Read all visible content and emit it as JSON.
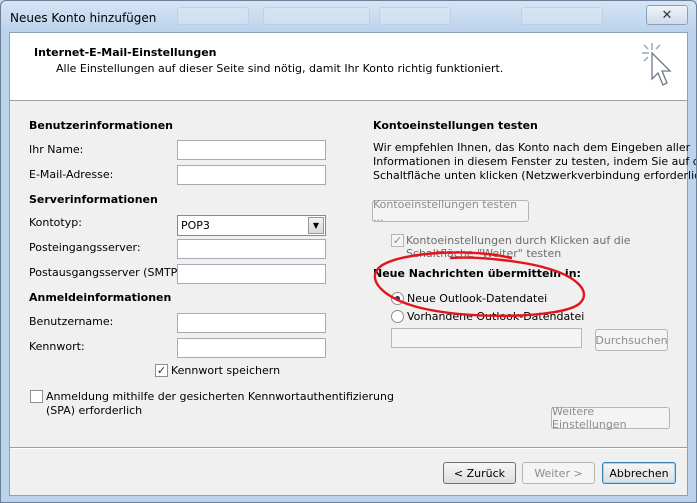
{
  "window": {
    "title": "Neues Konto hinzufügen",
    "close_label": "✕"
  },
  "header": {
    "title": "Internet-E-Mail-Einstellungen",
    "subtitle": "Alle Einstellungen auf dieser Seite sind nötig, damit Ihr Konto richtig funktioniert."
  },
  "user_info": {
    "heading": "Benutzerinformationen",
    "name_label": "Ihr Name:",
    "name_value": "",
    "email_label": "E-Mail-Adresse:",
    "email_value": ""
  },
  "server_info": {
    "heading": "Serverinformationen",
    "account_type_label": "Kontotyp:",
    "account_type_value": "POP3",
    "incoming_label": "Posteingangsserver:",
    "incoming_value": "",
    "outgoing_label": "Postausgangsserver (SMTP):",
    "outgoing_value": ""
  },
  "login_info": {
    "heading": "Anmeldeinformationen",
    "username_label": "Benutzername:",
    "username_value": "",
    "password_label": "Kennwort:",
    "password_value": "",
    "remember_password_label": "Kennwort speichern",
    "remember_password_checked": true,
    "spa_label_line1": "Anmeldung mithilfe der gesicherten Kennwortauthentifizierung",
    "spa_label_line2": "(SPA) erforderlich",
    "spa_checked": false
  },
  "test_settings": {
    "heading": "Kontoeinstellungen testen",
    "description_line1": "Wir empfehlen Ihnen, das Konto nach dem Eingeben aller",
    "description_line2": "Informationen in diesem Fenster zu testen, indem Sie auf die",
    "description_line3": "Schaltfläche unten klicken (Netzwerkverbindung erforderlich).",
    "test_button_label": "Kontoeinstellungen testen ...",
    "auto_test_line1": "Kontoeinstellungen durch Klicken auf die",
    "auto_test_line2": "Schaltfläche \"Weiter\" testen",
    "auto_test_checked": true
  },
  "deliver": {
    "heading": "Neue Nachrichten übermitteln in:",
    "option_new_label": "Neue Outlook-Datendatei",
    "option_existing_label": "Vorhandene Outlook-Datendatei",
    "selected": "new",
    "path_value": "",
    "browse_label": "Durchsuchen"
  },
  "more_settings_label": "Weitere Einstellungen",
  "footer": {
    "back_label": "< Zurück",
    "next_label": "Weiter >",
    "cancel_label": "Abbrechen"
  },
  "colors": {
    "annotation": "#e4141b"
  }
}
